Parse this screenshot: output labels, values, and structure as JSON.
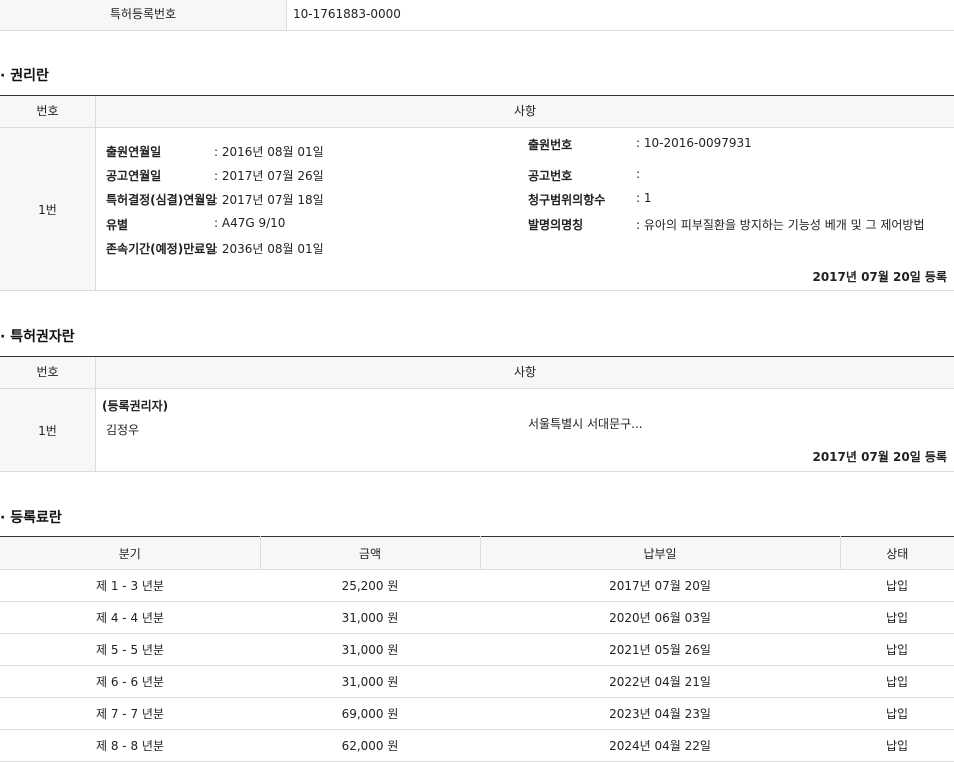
{
  "reg_number": {
    "label": "특허등록번호",
    "value": "10-1761883-0000"
  },
  "rights": {
    "title": "· 권리란",
    "headers": {
      "no": "번호",
      "detail": "사항"
    },
    "row_no": "1번",
    "left": [
      {
        "key": "출원연월일",
        "value": ": 2016년 08월 01일"
      },
      {
        "key": "공고연월일",
        "value": ": 2017년 07월 26일"
      },
      {
        "key": "특허결정(심결)연월일",
        "value": ": 2017년 07월 18일"
      },
      {
        "key": "유별",
        "value": ": A47G 9/10"
      },
      {
        "key": "존속기간(예정)만료일",
        "value": ": 2036년 08월 01일"
      }
    ],
    "right": [
      {
        "key": "출원번호",
        "value": ": 10-2016-0097931"
      },
      {
        "key": "공고번호",
        "value": ":"
      },
      {
        "key": "청구범위의항수",
        "value": ": 1"
      },
      {
        "key": "발명의명칭",
        "value": ": 유아의 피부질환을 방지하는 기능성 베개 및 그 제어방법"
      }
    ],
    "registered": "2017년 07월 20일 등록"
  },
  "owners": {
    "title": "· 특허권자란",
    "headers": {
      "no": "번호",
      "detail": "사항"
    },
    "row_no": "1번",
    "role": "(등록권리자)",
    "name": "김정우",
    "address": "서울특별시 서대문구...",
    "registered": "2017년 07월 20일 등록"
  },
  "fees": {
    "title": "· 등록료란",
    "headers": {
      "period": "분기",
      "amount": "금액",
      "paid_date": "납부일",
      "status": "상태"
    },
    "rows": [
      {
        "period": "제 1 - 3 년분",
        "amount": "25,200 원",
        "paid_date": "2017년 07월 20일",
        "status": "납입"
      },
      {
        "period": "제 4 - 4 년분",
        "amount": "31,000 원",
        "paid_date": "2020년 06월 03일",
        "status": "납입"
      },
      {
        "period": "제 5 - 5 년분",
        "amount": "31,000 원",
        "paid_date": "2021년 05월 26일",
        "status": "납입"
      },
      {
        "period": "제 6 - 6 년분",
        "amount": "31,000 원",
        "paid_date": "2022년 04월 21일",
        "status": "납입"
      },
      {
        "period": "제 7 - 7 년분",
        "amount": "69,000 원",
        "paid_date": "2023년 04월 23일",
        "status": "납입"
      },
      {
        "period": "제 8 - 8 년분",
        "amount": "62,000 원",
        "paid_date": "2024년 04월 22일",
        "status": "납입"
      }
    ]
  }
}
